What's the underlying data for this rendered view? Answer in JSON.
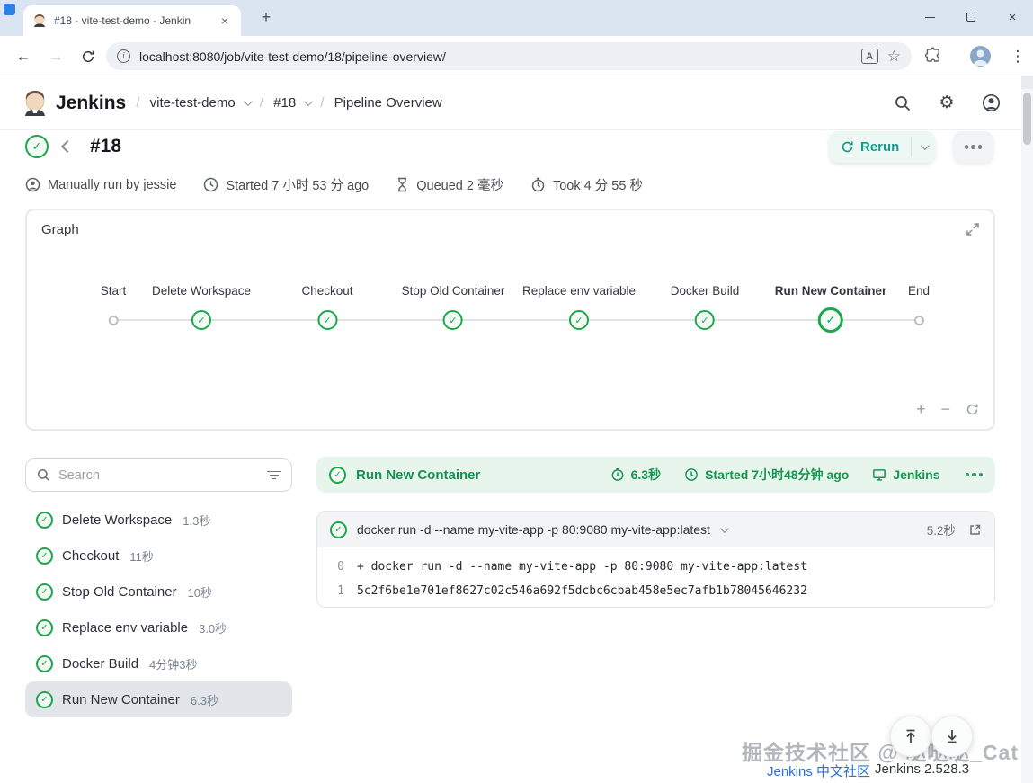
{
  "icons": {
    "check": "✓",
    "close": "×",
    "plus": "+",
    "minus": "−",
    "back": "←",
    "forward": "→",
    "star": "☆",
    "kebab": "⋮",
    "info": "i",
    "translate": "A",
    "gear": "⚙"
  },
  "browser": {
    "tab_title": "#18 - vite-test-demo - Jenkin",
    "url": "localhost:8080/job/vite-test-demo/18/pipeline-overview/"
  },
  "header": {
    "brand": "Jenkins",
    "sep": "/",
    "crumbs": [
      "vite-test-demo",
      "#18",
      "Pipeline Overview"
    ]
  },
  "build": {
    "number": "#18",
    "rerun": "Rerun",
    "meta": [
      "Manually run by jessie",
      "Started 7 小时 53 分 ago",
      "Queued 2 毫秒",
      "Took 4 分 55 秒"
    ]
  },
  "graph": {
    "title": "Graph",
    "stages": [
      "Start",
      "Delete Workspace",
      "Checkout",
      "Stop Old Container",
      "Replace env variable",
      "Docker Build",
      "Run New Container",
      "End"
    ]
  },
  "sidebar": {
    "search_placeholder": "Search",
    "stages": [
      {
        "name": "Delete Workspace",
        "duration": "1.3秒"
      },
      {
        "name": "Checkout",
        "duration": "11秒"
      },
      {
        "name": "Stop Old Container",
        "duration": "10秒"
      },
      {
        "name": "Replace env variable",
        "duration": "3.0秒"
      },
      {
        "name": "Docker Build",
        "duration": "4分钟3秒"
      },
      {
        "name": "Run New Container",
        "duration": "6.3秒"
      }
    ]
  },
  "panel": {
    "title": "Run New Container",
    "duration": "6.3秒",
    "started": "Started 7小时48分钟 ago",
    "agent": "Jenkins",
    "step": {
      "command": "docker run -d --name my-vite-app -p 80:9080 my-vite-app:latest",
      "duration": "5.2秒",
      "log": [
        {
          "num": "0",
          "text": "+ docker run -d --name my-vite-app -p 80:9080 my-vite-app:latest"
        },
        {
          "num": "1",
          "text": "5c2f6be1e701ef8627c02c546a692f5dcbc6cbab458e5ec7afb1b78045646232"
        }
      ]
    }
  },
  "footer": {
    "watermark": "掘金技术社区 @ 哒哒哒_Cat",
    "community": "Jenkins 中文社区",
    "version": "Jenkins 2.528.3"
  },
  "colors": {
    "success_green": "#1ea64b",
    "rerun_teal": "#0f9d8c",
    "link_blue": "#2a6fdb",
    "panel_green_bg": "#e7f5ec"
  }
}
